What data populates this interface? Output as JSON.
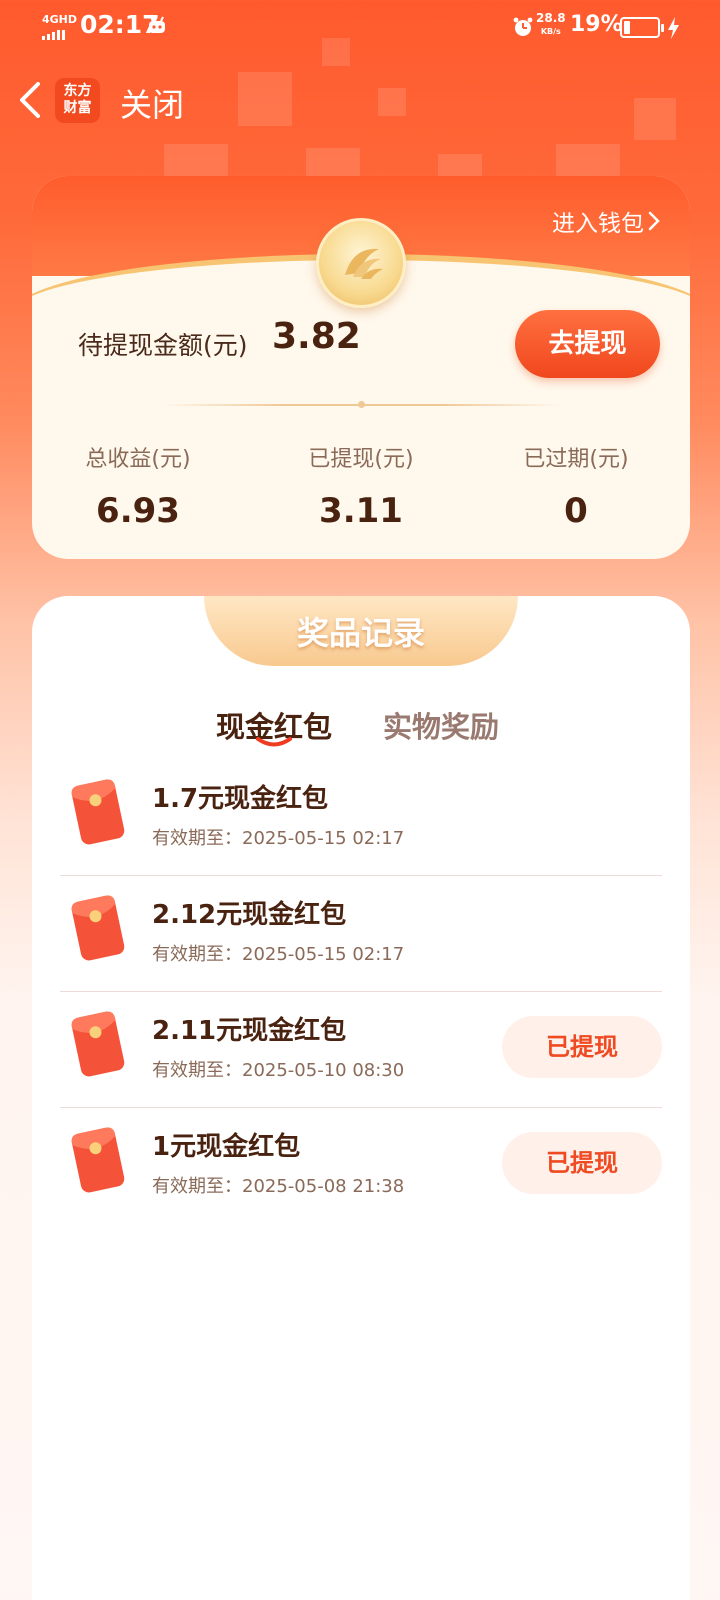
{
  "status_bar": {
    "network": "4GHD",
    "time": "02:17",
    "speed_value": "28.8",
    "speed_unit": "KB/s",
    "battery_percent": "19%",
    "battery_level": 0.19
  },
  "header": {
    "logo_line1": "东方",
    "logo_line2": "财富",
    "close_label": "关闭"
  },
  "wallet": {
    "enter_wallet_label": "进入钱包",
    "pending_label": "待提现金额(元)",
    "pending_value": "3.82",
    "withdraw_button": "去提现",
    "stats": [
      {
        "label": "总收益(元)",
        "value": "6.93"
      },
      {
        "label": "已提现(元)",
        "value": "3.11"
      },
      {
        "label": "已过期(元)",
        "value": "0"
      }
    ]
  },
  "records": {
    "title": "奖品记录",
    "tabs": [
      {
        "label": "现金红包",
        "active": true
      },
      {
        "label": "实物奖励",
        "active": false
      }
    ],
    "items": [
      {
        "title": "1.7元现金红包",
        "expiry": "有效期至：2025-05-15 02:17",
        "status": ""
      },
      {
        "title": "2.12元现金红包",
        "expiry": "有效期至：2025-05-15 02:17",
        "status": ""
      },
      {
        "title": "2.11元现金红包",
        "expiry": "有效期至：2025-05-10 08:30",
        "status": "已提现"
      },
      {
        "title": "1元现金红包",
        "expiry": "有效期至：2025-05-08 21:38",
        "status": "已提现"
      }
    ]
  },
  "colors": {
    "brand_orange": "#ff5a2e",
    "accent_red": "#ef4a22",
    "text_dark": "#4a2210",
    "gold": "#f8c98f"
  },
  "icons": [
    "back-arrow-icon",
    "alarm-icon",
    "battery-icon",
    "charging-bolt-icon",
    "chevron-right-icon",
    "coin-icon",
    "red-envelope-icon"
  ]
}
